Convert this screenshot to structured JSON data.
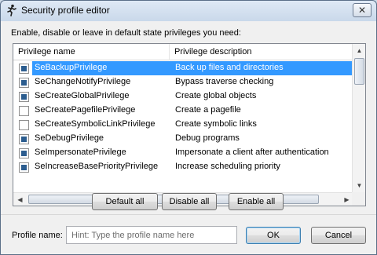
{
  "window": {
    "title": "Security profile editor",
    "close_glyph": "✕"
  },
  "instruction": "Enable, disable or leave in default state privileges you need:",
  "list": {
    "columns": [
      "Privilege name",
      "Privilege description"
    ],
    "rows": [
      {
        "name": "SeBackupPrivilege",
        "desc": "Back up files and directories",
        "state": "enabled",
        "selected": true
      },
      {
        "name": "SeChangeNotifyPrivilege",
        "desc": "Bypass traverse checking",
        "state": "enabled",
        "selected": false
      },
      {
        "name": "SeCreateGlobalPrivilege",
        "desc": "Create global objects",
        "state": "enabled",
        "selected": false
      },
      {
        "name": "SeCreatePagefilePrivilege",
        "desc": "Create a pagefile",
        "state": "default",
        "selected": false
      },
      {
        "name": "SeCreateSymbolicLinkPrivilege",
        "desc": "Create symbolic links",
        "state": "default",
        "selected": false
      },
      {
        "name": "SeDebugPrivilege",
        "desc": "Debug programs",
        "state": "enabled",
        "selected": false
      },
      {
        "name": "SeImpersonatePrivilege",
        "desc": "Impersonate a client after authentication",
        "state": "enabled",
        "selected": false
      },
      {
        "name": "SeIncreaseBasePriorityPrivilege",
        "desc": "Increase scheduling priority",
        "state": "enabled",
        "selected": false
      }
    ]
  },
  "buttons": {
    "default_all": "Default all",
    "disable_all": "Disable all",
    "enable_all": "Enable all",
    "ok": "OK",
    "cancel": "Cancel"
  },
  "profile": {
    "label": "Profile name:",
    "value": "",
    "placeholder": "Hint: Type the profile name here"
  },
  "colors": {
    "selection": "#3399ff",
    "checked_fill": "#2c5d8f"
  }
}
